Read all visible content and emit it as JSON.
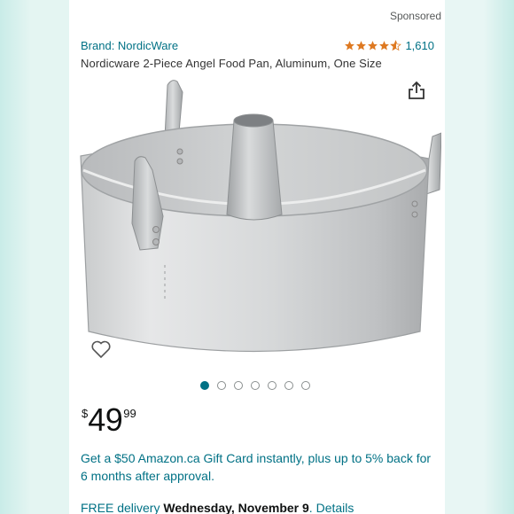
{
  "header": {
    "sponsored": "Sponsored"
  },
  "product": {
    "brand": "Brand: NordicWare",
    "rating": 4.6,
    "rating_count": "1,610",
    "title": "Nordicware 2-Piece Angel Food Pan, Aluminum, One Size",
    "image_icon": "angel-food-pan-image"
  },
  "carousel": {
    "total": 7,
    "active_index": 0
  },
  "price": {
    "symbol": "$",
    "whole": "49",
    "fraction": "99"
  },
  "promo": {
    "text": "Get a $50 Amazon.ca Gift Card instantly, plus up to 5% back for 6 months after approval."
  },
  "delivery": {
    "prefix": "FREE delivery",
    "date": "Wednesday, November 9",
    "suffix": ". ",
    "details_label": "Details"
  },
  "colors": {
    "link": "#007185",
    "star": "#de7921",
    "text": "#0f1111",
    "background": "#e4f5f2"
  },
  "icons": {
    "share": "share-icon",
    "wishlist": "heart-icon"
  }
}
